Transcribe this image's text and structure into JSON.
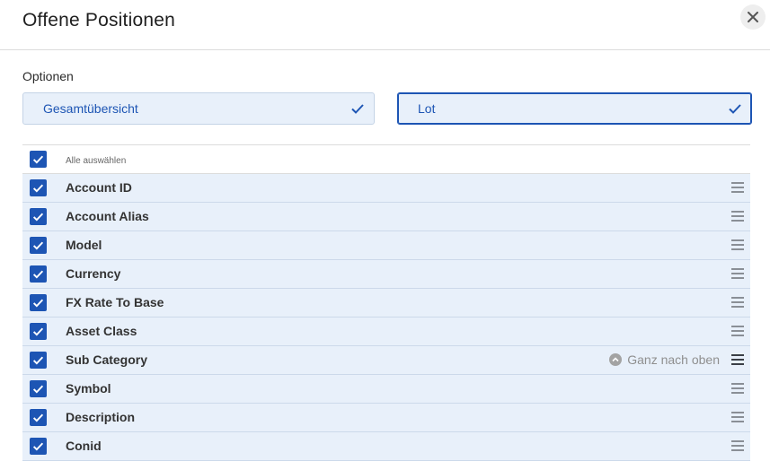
{
  "dialog": {
    "title": "Offene Positionen"
  },
  "options": {
    "label": "Optionen",
    "items": [
      {
        "label": "Gesamtübersicht",
        "selected": false
      },
      {
        "label": "Lot",
        "selected": true
      }
    ]
  },
  "list": {
    "select_all_label": "Alle auswählen",
    "move_top_label": "Ganz nach oben",
    "items": [
      {
        "label": "Account ID",
        "checked": true
      },
      {
        "label": "Account Alias",
        "checked": true
      },
      {
        "label": "Model",
        "checked": true
      },
      {
        "label": "Currency",
        "checked": true
      },
      {
        "label": "FX Rate To Base",
        "checked": true
      },
      {
        "label": "Asset Class",
        "checked": true
      },
      {
        "label": "Sub Category",
        "checked": true
      },
      {
        "label": "Symbol",
        "checked": true
      },
      {
        "label": "Description",
        "checked": true
      },
      {
        "label": "Conid",
        "checked": true
      }
    ]
  },
  "colors": {
    "accent": "#1d55b4",
    "row_bg": "#e8f0fa"
  }
}
